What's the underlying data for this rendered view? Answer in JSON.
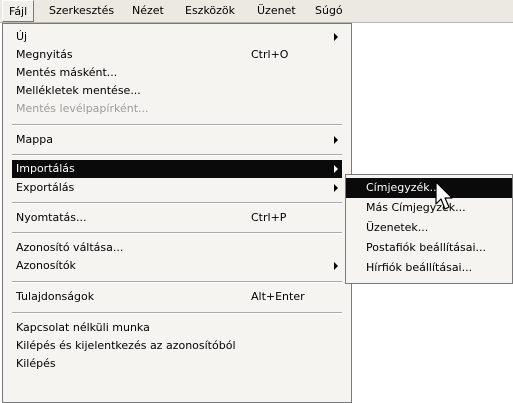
{
  "menubar": {
    "items": [
      {
        "label": "Fájl"
      },
      {
        "label": "Szerkesztés"
      },
      {
        "label": "Nézet"
      },
      {
        "label": "Eszközök"
      },
      {
        "label": "Üzenet"
      },
      {
        "label": "Súgó"
      }
    ]
  },
  "file_menu": {
    "items": [
      {
        "label": "Új",
        "has_submenu": true
      },
      {
        "label": "Megnyitás",
        "shortcut": "Ctrl+O"
      },
      {
        "label": "Mentés másként..."
      },
      {
        "label": "Mellékletek mentése..."
      },
      {
        "label": "Mentés levélpapírként...",
        "disabled": true
      },
      {
        "label": "Mappa",
        "has_submenu": true
      },
      {
        "label": "Importálás",
        "has_submenu": true,
        "highlighted": true
      },
      {
        "label": "Exportálás",
        "has_submenu": true
      },
      {
        "label": "Nyomtatás...",
        "shortcut": "Ctrl+P"
      },
      {
        "label": "Azonosító váltása..."
      },
      {
        "label": "Azonosítók",
        "has_submenu": true
      },
      {
        "label": "Tulajdonságok",
        "shortcut": "Alt+Enter"
      },
      {
        "label": "Kapcsolat nélküli munka"
      },
      {
        "label": "Kilépés és kijelentkezés az azonosítóból"
      },
      {
        "label": "Kilépés"
      }
    ]
  },
  "import_submenu": {
    "items": [
      {
        "label": "Címjegyzék...",
        "highlighted": true
      },
      {
        "label": "Más Címjegyzék..."
      },
      {
        "label": "Üzenetek..."
      },
      {
        "label": "Postafiók beállításai..."
      },
      {
        "label": "Hírfiók beállításai..."
      }
    ]
  },
  "colors": {
    "menu_background": "#f5f4f0",
    "highlight": "#0a0a0a",
    "highlight_text": "#ffffff",
    "disabled_text": "#9b9b9b"
  }
}
